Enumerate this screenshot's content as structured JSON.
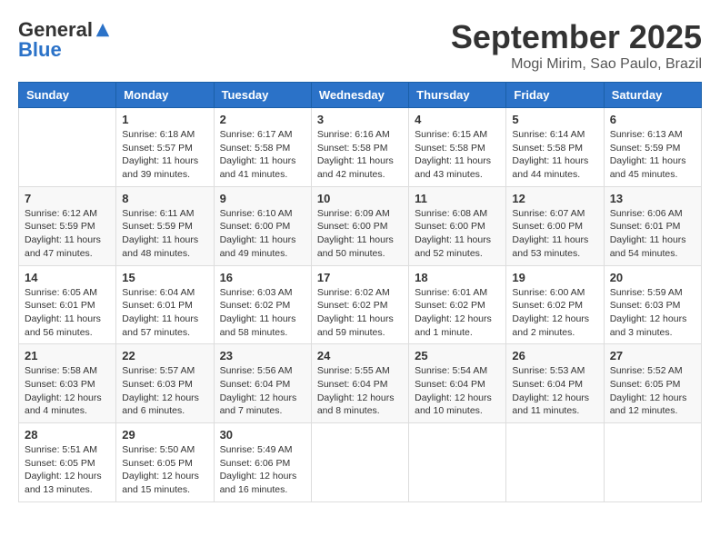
{
  "header": {
    "logo": {
      "general": "General",
      "blue": "Blue"
    },
    "month": "September 2025",
    "location": "Mogi Mirim, Sao Paulo, Brazil"
  },
  "days_of_week": [
    "Sunday",
    "Monday",
    "Tuesday",
    "Wednesday",
    "Thursday",
    "Friday",
    "Saturday"
  ],
  "weeks": [
    [
      {
        "day": "",
        "info": ""
      },
      {
        "day": "1",
        "info": "Sunrise: 6:18 AM\nSunset: 5:57 PM\nDaylight: 11 hours\nand 39 minutes."
      },
      {
        "day": "2",
        "info": "Sunrise: 6:17 AM\nSunset: 5:58 PM\nDaylight: 11 hours\nand 41 minutes."
      },
      {
        "day": "3",
        "info": "Sunrise: 6:16 AM\nSunset: 5:58 PM\nDaylight: 11 hours\nand 42 minutes."
      },
      {
        "day": "4",
        "info": "Sunrise: 6:15 AM\nSunset: 5:58 PM\nDaylight: 11 hours\nand 43 minutes."
      },
      {
        "day": "5",
        "info": "Sunrise: 6:14 AM\nSunset: 5:58 PM\nDaylight: 11 hours\nand 44 minutes."
      },
      {
        "day": "6",
        "info": "Sunrise: 6:13 AM\nSunset: 5:59 PM\nDaylight: 11 hours\nand 45 minutes."
      }
    ],
    [
      {
        "day": "7",
        "info": "Sunrise: 6:12 AM\nSunset: 5:59 PM\nDaylight: 11 hours\nand 47 minutes."
      },
      {
        "day": "8",
        "info": "Sunrise: 6:11 AM\nSunset: 5:59 PM\nDaylight: 11 hours\nand 48 minutes."
      },
      {
        "day": "9",
        "info": "Sunrise: 6:10 AM\nSunset: 6:00 PM\nDaylight: 11 hours\nand 49 minutes."
      },
      {
        "day": "10",
        "info": "Sunrise: 6:09 AM\nSunset: 6:00 PM\nDaylight: 11 hours\nand 50 minutes."
      },
      {
        "day": "11",
        "info": "Sunrise: 6:08 AM\nSunset: 6:00 PM\nDaylight: 11 hours\nand 52 minutes."
      },
      {
        "day": "12",
        "info": "Sunrise: 6:07 AM\nSunset: 6:00 PM\nDaylight: 11 hours\nand 53 minutes."
      },
      {
        "day": "13",
        "info": "Sunrise: 6:06 AM\nSunset: 6:01 PM\nDaylight: 11 hours\nand 54 minutes."
      }
    ],
    [
      {
        "day": "14",
        "info": "Sunrise: 6:05 AM\nSunset: 6:01 PM\nDaylight: 11 hours\nand 56 minutes."
      },
      {
        "day": "15",
        "info": "Sunrise: 6:04 AM\nSunset: 6:01 PM\nDaylight: 11 hours\nand 57 minutes."
      },
      {
        "day": "16",
        "info": "Sunrise: 6:03 AM\nSunset: 6:02 PM\nDaylight: 11 hours\nand 58 minutes."
      },
      {
        "day": "17",
        "info": "Sunrise: 6:02 AM\nSunset: 6:02 PM\nDaylight: 11 hours\nand 59 minutes."
      },
      {
        "day": "18",
        "info": "Sunrise: 6:01 AM\nSunset: 6:02 PM\nDaylight: 12 hours\nand 1 minute."
      },
      {
        "day": "19",
        "info": "Sunrise: 6:00 AM\nSunset: 6:02 PM\nDaylight: 12 hours\nand 2 minutes."
      },
      {
        "day": "20",
        "info": "Sunrise: 5:59 AM\nSunset: 6:03 PM\nDaylight: 12 hours\nand 3 minutes."
      }
    ],
    [
      {
        "day": "21",
        "info": "Sunrise: 5:58 AM\nSunset: 6:03 PM\nDaylight: 12 hours\nand 4 minutes."
      },
      {
        "day": "22",
        "info": "Sunrise: 5:57 AM\nSunset: 6:03 PM\nDaylight: 12 hours\nand 6 minutes."
      },
      {
        "day": "23",
        "info": "Sunrise: 5:56 AM\nSunset: 6:04 PM\nDaylight: 12 hours\nand 7 minutes."
      },
      {
        "day": "24",
        "info": "Sunrise: 5:55 AM\nSunset: 6:04 PM\nDaylight: 12 hours\nand 8 minutes."
      },
      {
        "day": "25",
        "info": "Sunrise: 5:54 AM\nSunset: 6:04 PM\nDaylight: 12 hours\nand 10 minutes."
      },
      {
        "day": "26",
        "info": "Sunrise: 5:53 AM\nSunset: 6:04 PM\nDaylight: 12 hours\nand 11 minutes."
      },
      {
        "day": "27",
        "info": "Sunrise: 5:52 AM\nSunset: 6:05 PM\nDaylight: 12 hours\nand 12 minutes."
      }
    ],
    [
      {
        "day": "28",
        "info": "Sunrise: 5:51 AM\nSunset: 6:05 PM\nDaylight: 12 hours\nand 13 minutes."
      },
      {
        "day": "29",
        "info": "Sunrise: 5:50 AM\nSunset: 6:05 PM\nDaylight: 12 hours\nand 15 minutes."
      },
      {
        "day": "30",
        "info": "Sunrise: 5:49 AM\nSunset: 6:06 PM\nDaylight: 12 hours\nand 16 minutes."
      },
      {
        "day": "",
        "info": ""
      },
      {
        "day": "",
        "info": ""
      },
      {
        "day": "",
        "info": ""
      },
      {
        "day": "",
        "info": ""
      }
    ]
  ]
}
